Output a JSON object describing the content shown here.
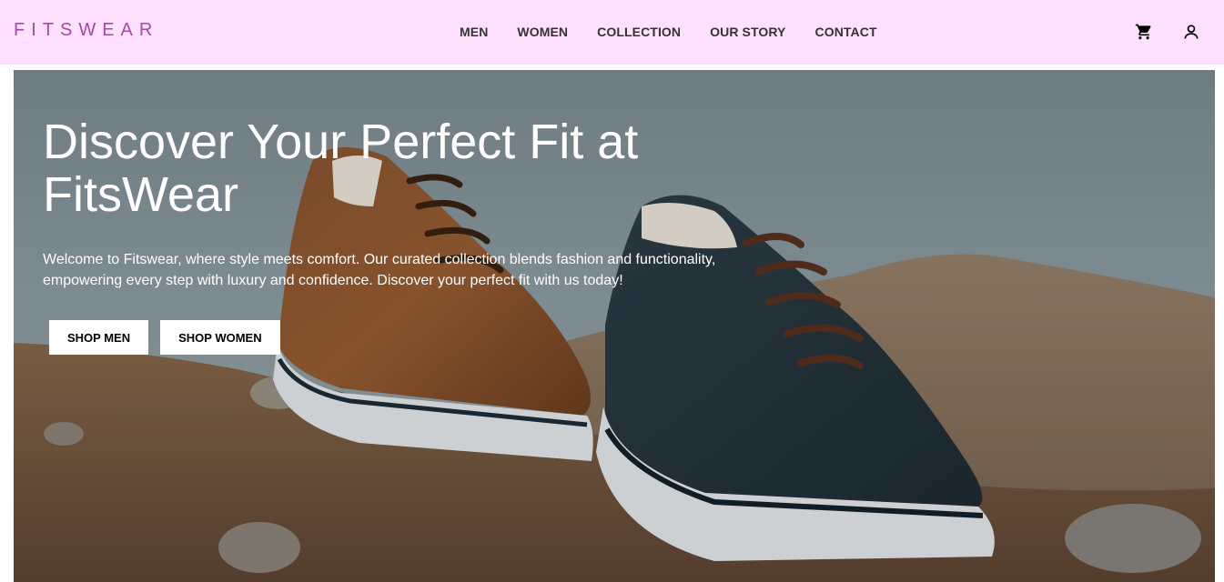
{
  "header": {
    "logo": "FITSWEAR",
    "nav": [
      {
        "label": "MEN"
      },
      {
        "label": "WOMEN"
      },
      {
        "label": "COLLECTION"
      },
      {
        "label": "OUR STORY"
      },
      {
        "label": "CONTACT"
      }
    ],
    "icons": {
      "cart": "cart-icon",
      "account": "user-icon"
    }
  },
  "hero": {
    "title": "Discover Your Perfect Fit at FitsWear",
    "description": "Welcome to Fitswear, where style meets comfort. Our curated collection blends fashion and functionality, empowering every step with luxury and confidence. Discover your perfect fit with us today!",
    "buttons": {
      "shop_men": "SHOP MEN",
      "shop_women": "SHOP WOMEN"
    },
    "image": "two-leather-sneakers-on-rocky-hill"
  },
  "colors": {
    "header_bg": "#ffe0ff",
    "logo": "#a34aa6",
    "nav_text": "#333333",
    "button_bg": "#ffffff"
  }
}
